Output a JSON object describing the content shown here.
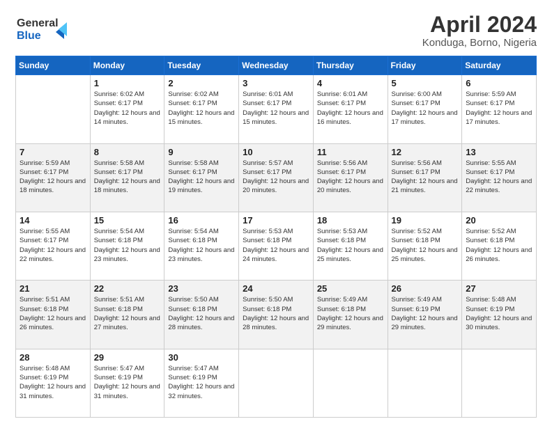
{
  "header": {
    "logo_line1": "General",
    "logo_line2": "Blue",
    "title": "April 2024",
    "subtitle": "Konduga, Borno, Nigeria"
  },
  "days_of_week": [
    "Sunday",
    "Monday",
    "Tuesday",
    "Wednesday",
    "Thursday",
    "Friday",
    "Saturday"
  ],
  "weeks": [
    [
      {
        "day": "",
        "sunrise": "",
        "sunset": "",
        "daylight": ""
      },
      {
        "day": "1",
        "sunrise": "Sunrise: 6:02 AM",
        "sunset": "Sunset: 6:17 PM",
        "daylight": "Daylight: 12 hours and 14 minutes."
      },
      {
        "day": "2",
        "sunrise": "Sunrise: 6:02 AM",
        "sunset": "Sunset: 6:17 PM",
        "daylight": "Daylight: 12 hours and 15 minutes."
      },
      {
        "day": "3",
        "sunrise": "Sunrise: 6:01 AM",
        "sunset": "Sunset: 6:17 PM",
        "daylight": "Daylight: 12 hours and 15 minutes."
      },
      {
        "day": "4",
        "sunrise": "Sunrise: 6:01 AM",
        "sunset": "Sunset: 6:17 PM",
        "daylight": "Daylight: 12 hours and 16 minutes."
      },
      {
        "day": "5",
        "sunrise": "Sunrise: 6:00 AM",
        "sunset": "Sunset: 6:17 PM",
        "daylight": "Daylight: 12 hours and 17 minutes."
      },
      {
        "day": "6",
        "sunrise": "Sunrise: 5:59 AM",
        "sunset": "Sunset: 6:17 PM",
        "daylight": "Daylight: 12 hours and 17 minutes."
      }
    ],
    [
      {
        "day": "7",
        "sunrise": "Sunrise: 5:59 AM",
        "sunset": "Sunset: 6:17 PM",
        "daylight": "Daylight: 12 hours and 18 minutes."
      },
      {
        "day": "8",
        "sunrise": "Sunrise: 5:58 AM",
        "sunset": "Sunset: 6:17 PM",
        "daylight": "Daylight: 12 hours and 18 minutes."
      },
      {
        "day": "9",
        "sunrise": "Sunrise: 5:58 AM",
        "sunset": "Sunset: 6:17 PM",
        "daylight": "Daylight: 12 hours and 19 minutes."
      },
      {
        "day": "10",
        "sunrise": "Sunrise: 5:57 AM",
        "sunset": "Sunset: 6:17 PM",
        "daylight": "Daylight: 12 hours and 20 minutes."
      },
      {
        "day": "11",
        "sunrise": "Sunrise: 5:56 AM",
        "sunset": "Sunset: 6:17 PM",
        "daylight": "Daylight: 12 hours and 20 minutes."
      },
      {
        "day": "12",
        "sunrise": "Sunrise: 5:56 AM",
        "sunset": "Sunset: 6:17 PM",
        "daylight": "Daylight: 12 hours and 21 minutes."
      },
      {
        "day": "13",
        "sunrise": "Sunrise: 5:55 AM",
        "sunset": "Sunset: 6:17 PM",
        "daylight": "Daylight: 12 hours and 22 minutes."
      }
    ],
    [
      {
        "day": "14",
        "sunrise": "Sunrise: 5:55 AM",
        "sunset": "Sunset: 6:17 PM",
        "daylight": "Daylight: 12 hours and 22 minutes."
      },
      {
        "day": "15",
        "sunrise": "Sunrise: 5:54 AM",
        "sunset": "Sunset: 6:18 PM",
        "daylight": "Daylight: 12 hours and 23 minutes."
      },
      {
        "day": "16",
        "sunrise": "Sunrise: 5:54 AM",
        "sunset": "Sunset: 6:18 PM",
        "daylight": "Daylight: 12 hours and 23 minutes."
      },
      {
        "day": "17",
        "sunrise": "Sunrise: 5:53 AM",
        "sunset": "Sunset: 6:18 PM",
        "daylight": "Daylight: 12 hours and 24 minutes."
      },
      {
        "day": "18",
        "sunrise": "Sunrise: 5:53 AM",
        "sunset": "Sunset: 6:18 PM",
        "daylight": "Daylight: 12 hours and 25 minutes."
      },
      {
        "day": "19",
        "sunrise": "Sunrise: 5:52 AM",
        "sunset": "Sunset: 6:18 PM",
        "daylight": "Daylight: 12 hours and 25 minutes."
      },
      {
        "day": "20",
        "sunrise": "Sunrise: 5:52 AM",
        "sunset": "Sunset: 6:18 PM",
        "daylight": "Daylight: 12 hours and 26 minutes."
      }
    ],
    [
      {
        "day": "21",
        "sunrise": "Sunrise: 5:51 AM",
        "sunset": "Sunset: 6:18 PM",
        "daylight": "Daylight: 12 hours and 26 minutes."
      },
      {
        "day": "22",
        "sunrise": "Sunrise: 5:51 AM",
        "sunset": "Sunset: 6:18 PM",
        "daylight": "Daylight: 12 hours and 27 minutes."
      },
      {
        "day": "23",
        "sunrise": "Sunrise: 5:50 AM",
        "sunset": "Sunset: 6:18 PM",
        "daylight": "Daylight: 12 hours and 28 minutes."
      },
      {
        "day": "24",
        "sunrise": "Sunrise: 5:50 AM",
        "sunset": "Sunset: 6:18 PM",
        "daylight": "Daylight: 12 hours and 28 minutes."
      },
      {
        "day": "25",
        "sunrise": "Sunrise: 5:49 AM",
        "sunset": "Sunset: 6:18 PM",
        "daylight": "Daylight: 12 hours and 29 minutes."
      },
      {
        "day": "26",
        "sunrise": "Sunrise: 5:49 AM",
        "sunset": "Sunset: 6:19 PM",
        "daylight": "Daylight: 12 hours and 29 minutes."
      },
      {
        "day": "27",
        "sunrise": "Sunrise: 5:48 AM",
        "sunset": "Sunset: 6:19 PM",
        "daylight": "Daylight: 12 hours and 30 minutes."
      }
    ],
    [
      {
        "day": "28",
        "sunrise": "Sunrise: 5:48 AM",
        "sunset": "Sunset: 6:19 PM",
        "daylight": "Daylight: 12 hours and 31 minutes."
      },
      {
        "day": "29",
        "sunrise": "Sunrise: 5:47 AM",
        "sunset": "Sunset: 6:19 PM",
        "daylight": "Daylight: 12 hours and 31 minutes."
      },
      {
        "day": "30",
        "sunrise": "Sunrise: 5:47 AM",
        "sunset": "Sunset: 6:19 PM",
        "daylight": "Daylight: 12 hours and 32 minutes."
      },
      {
        "day": "",
        "sunrise": "",
        "sunset": "",
        "daylight": ""
      },
      {
        "day": "",
        "sunrise": "",
        "sunset": "",
        "daylight": ""
      },
      {
        "day": "",
        "sunrise": "",
        "sunset": "",
        "daylight": ""
      },
      {
        "day": "",
        "sunrise": "",
        "sunset": "",
        "daylight": ""
      }
    ]
  ]
}
